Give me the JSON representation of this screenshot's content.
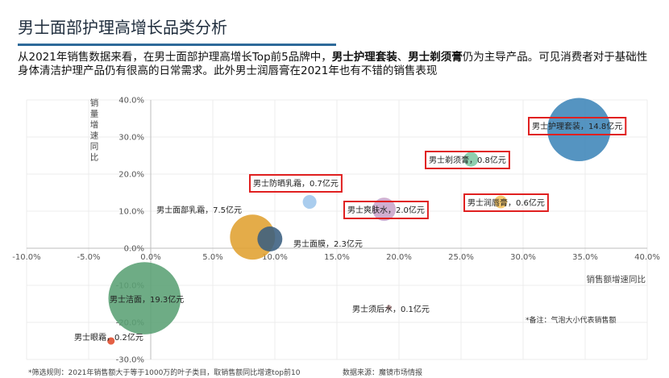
{
  "page": {
    "title": "男士面部护理高增长品类分析",
    "intro_parts": [
      {
        "text": "从2021年销售数据来看，在男士面部护理高增长Top前5品牌中，",
        "bold": false
      },
      {
        "text": "男士护理套装",
        "bold": true
      },
      {
        "text": "、",
        "bold": false
      },
      {
        "text": "男士剃须膏",
        "bold": true
      },
      {
        "text": "仍为主导产品。可见消费者对于基础性身体清洁护理产品仍有很高的日常需求。此外男士润唇膏在2021年也有不错的销售表现",
        "bold": false
      }
    ],
    "footnote_rule": "*筛选规则：2021年销售额大于等于1000万的叶子类目，取销售额同比增速top前10",
    "footnote_source": "数据来源：魔镜市场情报",
    "note": "*备注：气泡大小代表销售额"
  },
  "chart_data": {
    "type": "scatter",
    "xlabel": "销售额增速同比",
    "ylabel": "销量增速同比",
    "xlim": [
      -10,
      40
    ],
    "ylim": [
      -30,
      40
    ],
    "x_ticks": [
      "-10.0%",
      "-5.0%",
      "0.0%",
      "5.0%",
      "10.0%",
      "15.0%",
      "20.0%",
      "25.0%",
      "30.0%",
      "35.0%",
      "40.0%"
    ],
    "y_ticks": [
      "-30.0%",
      "-20.0%",
      "-10.0%",
      "0.0%",
      "10.0%",
      "20.0%",
      "30.0%",
      "40.0%"
    ],
    "grid": true,
    "points": [
      {
        "name": "男士护理套装",
        "label": "男士护理套装，14.8亿元",
        "sales_yi": 14.8,
        "x": 34.5,
        "y": 32.0,
        "color": "#3d85b8",
        "highlight": true
      },
      {
        "name": "男士剃须膏",
        "label": "男士剃须膏，0.8亿元",
        "sales_yi": 0.8,
        "x": 25.8,
        "y": 24.0,
        "color": "#7fc8a4",
        "highlight": true
      },
      {
        "name": "男士润唇膏",
        "label": "男士润唇膏，0.6亿元",
        "sales_yi": 0.6,
        "x": 28.2,
        "y": 12.5,
        "color": "#f2c05a",
        "highlight": true
      },
      {
        "name": "男士防晒乳霜",
        "label": "男士防晒乳霜，0.7亿元",
        "sales_yi": 0.7,
        "x": 12.8,
        "y": 12.5,
        "color": "#9ec6ec",
        "highlight": true
      },
      {
        "name": "男士爽肤水",
        "label": "男士爽肤水，2.0亿元",
        "sales_yi": 2.0,
        "x": 18.8,
        "y": 10.5,
        "color": "#c9a4c9",
        "highlight": true
      },
      {
        "name": "男士面部乳霜",
        "label": "男士面部乳霜，7.5亿元",
        "sales_yi": 7.5,
        "x": 8.2,
        "y": 3.0,
        "color": "#e0a030",
        "highlight": false
      },
      {
        "name": "男士面膜",
        "label": "男士面膜，2.3亿元",
        "sales_yi": 2.3,
        "x": 9.6,
        "y": 2.5,
        "color": "#3a5f80",
        "highlight": false
      },
      {
        "name": "男士洁面",
        "label": "男士洁面，19.3亿元",
        "sales_yi": 19.3,
        "x": -0.5,
        "y": -13.5,
        "color": "#5aa074",
        "highlight": false
      },
      {
        "name": "男士须后水",
        "label": "男士须后水，0.1亿元",
        "sales_yi": 0.1,
        "x": 19.2,
        "y": -16.0,
        "color": "#c8a0a0",
        "highlight": false
      },
      {
        "name": "男士眼霜",
        "label": "男士眼霜，0.2亿元",
        "sales_yi": 0.2,
        "x": -3.2,
        "y": -25.0,
        "color": "#e04a2a",
        "highlight": false
      }
    ]
  }
}
